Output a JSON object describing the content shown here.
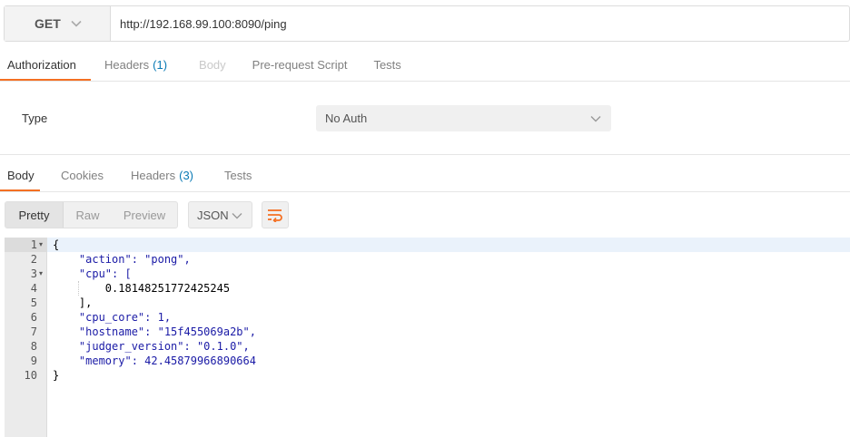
{
  "request": {
    "method": "GET",
    "url": "http://192.168.99.100:8090/ping"
  },
  "request_tabs": [
    {
      "label": "Authorization",
      "count": "",
      "state": "active"
    },
    {
      "label": "Headers",
      "count": "(1)",
      "state": "normal"
    },
    {
      "label": "Body",
      "count": "",
      "state": "disabled"
    },
    {
      "label": "Pre-request Script",
      "count": "",
      "state": "normal"
    },
    {
      "label": "Tests",
      "count": "",
      "state": "normal"
    }
  ],
  "auth": {
    "type_label": "Type",
    "selected": "No Auth"
  },
  "response_tabs": [
    {
      "label": "Body",
      "count": "",
      "state": "active"
    },
    {
      "label": "Cookies",
      "count": "",
      "state": "normal"
    },
    {
      "label": "Headers",
      "count": "(3)",
      "state": "normal"
    },
    {
      "label": "Tests",
      "count": "",
      "state": "normal"
    }
  ],
  "view_modes": [
    "Pretty",
    "Raw",
    "Preview"
  ],
  "active_view_mode": "Pretty",
  "format": "JSON",
  "colors": {
    "accent": "#f47023",
    "count": "#0a7ab5",
    "string": "#1a1aa6"
  },
  "icons": {
    "method_dropdown": "chevron-down-icon",
    "auth_dropdown": "chevron-down-icon",
    "format_dropdown": "chevron-down-icon",
    "wrap": "wrap-lines-icon",
    "fold": "fold-arrow-icon"
  },
  "code_lines": [
    {
      "num": "1",
      "fold": true,
      "text": "{"
    },
    {
      "num": "2",
      "fold": false,
      "text": "    \"action\": \"pong\","
    },
    {
      "num": "3",
      "fold": true,
      "text": "    \"cpu\": ["
    },
    {
      "num": "4",
      "fold": false,
      "text": "        0.18148251772425245"
    },
    {
      "num": "5",
      "fold": false,
      "text": "    ],"
    },
    {
      "num": "6",
      "fold": false,
      "text": "    \"cpu_core\": 1,"
    },
    {
      "num": "7",
      "fold": false,
      "text": "    \"hostname\": \"15f455069a2b\","
    },
    {
      "num": "8",
      "fold": false,
      "text": "    \"judger_version\": \"0.1.0\","
    },
    {
      "num": "9",
      "fold": false,
      "text": "    \"memory\": 42.45879966890664"
    },
    {
      "num": "10",
      "fold": false,
      "text": "}"
    }
  ]
}
